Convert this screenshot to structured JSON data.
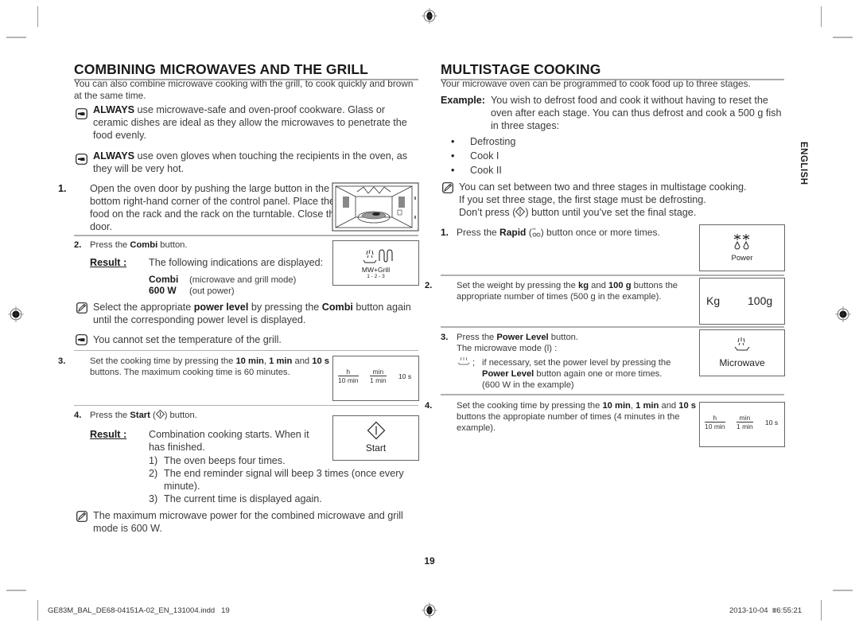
{
  "left": {
    "title": "COMBINING MICROWAVES AND THE GRILL",
    "intro": "You can also combine microwave cooking with the grill, to cook quickly and brown at the same time.",
    "warn1": {
      "bold": "ALWAYS",
      "text": " use microwave-safe and oven-proof cookware. Glass or ceramic dishes are ideal as they allow the microwaves to penetrate the food evenly."
    },
    "warn2": {
      "bold": "ALWAYS",
      "text": " use oven gloves when touching the recipients in the oven, as they will be very hot."
    },
    "step1": {
      "num": "1.",
      "text": "Open the oven door by pushing the large button in the bottom right-hand corner of the control panel. Place the food on the rack and the rack on the turntable. Close the door."
    },
    "step2": {
      "num": "2.",
      "pre": "Press the ",
      "bold": "Combi",
      "post": " button.",
      "result_label": "Result :",
      "result_text": "The following indications are displayed:",
      "ind1_label": "Combi",
      "ind1_desc": "(microwave and grill mode)",
      "ind2_label": "600 W",
      "ind2_desc": "(out power)",
      "display": {
        "label": "MW+Grill",
        "sub": "1 - 2 - 3"
      }
    },
    "note1": {
      "pre": "Select the appropriate ",
      "b1": "power level",
      "mid": " by pressing the ",
      "b2": "Combi",
      "post": " button again until the corresponding power level is displayed."
    },
    "warn3": "You cannot set the temperature of the grill.",
    "step3": {
      "num": "3.",
      "pre": "Set the cooking time by pressing the ",
      "b1": "10 min",
      "c1": ", ",
      "b2": "1 min",
      "c2": " and ",
      "b3": "10 s",
      "post": " buttons. The maximum cooking time is 60 minutes.",
      "display": {
        "h": "h",
        "h_sub": "10 min",
        "min": "min",
        "min_sub": "1 min",
        "s": "10 s"
      }
    },
    "step4": {
      "num": "4.",
      "pre": "Press the ",
      "bold": "Start",
      "post": " button.",
      "result_label": "Result :",
      "result_text": "Combination cooking starts. When it has finished.",
      "items": [
        {
          "n": "1)",
          "text": "The oven beeps four times."
        },
        {
          "n": "2)",
          "text": "The end reminder signal will beep 3 times (once every minute)."
        },
        {
          "n": "3)",
          "text": "The current time is displayed again."
        }
      ],
      "display": {
        "label": "Start"
      }
    },
    "note2": "The maximum microwave power for the combined microwave and grill mode is 600 W."
  },
  "right": {
    "title": "MULTISTAGE COOKING",
    "intro": "Your microwave oven can be programmed to cook food up to three stages.",
    "example_label": "Example:",
    "example_text": "You wish to defrost food and cook it without having to reset the oven after each stage. You can thus defrost and cook a 500 g fish in three stages:",
    "stages": [
      "Defrosting",
      "Cook I",
      "Cook II"
    ],
    "note": {
      "line1": "You can set between two and three stages in multistage cooking.",
      "line2": "If you set three stage, the first stage must be defrosting.",
      "line3_pre": "Don’t press (",
      "line3_post": ") button until you’ve set the final stage."
    },
    "step1": {
      "num": "1.",
      "pre": "Press the ",
      "bold": "Rapid",
      "post": " button once or more times.",
      "display": {
        "label": "Power"
      }
    },
    "step2": {
      "num": "2.",
      "pre": "Set the weight by pressing the ",
      "b1": "kg",
      "mid": " and ",
      "b2": "100 g",
      "post": " buttons the appropriate number of times (500 g in the example).",
      "display": {
        "kg": "Kg",
        "g": "100g"
      }
    },
    "step3": {
      "num": "3.",
      "pre": "Press the ",
      "bold": "Power Level",
      "post": " button.",
      "line2": "The microwave mode (l) :",
      "sub_sep": ";",
      "sub_pre": "if necessary, set the power level by pressing the ",
      "sub_bold": "Power Level",
      "sub_post": " button again one or more times.",
      "sub_line3": "(600 W in the example)",
      "display": {
        "label": "Microwave"
      }
    },
    "step4": {
      "num": "4.",
      "pre": "Set the cooking time by pressing the ",
      "b1": "10 min",
      "c1": ", ",
      "b2": "1 min",
      "c2": " and ",
      "b3": "10 s",
      "post": " buttons the appropiate number of times (4 minutes in the example).",
      "display": {
        "h": "h",
        "h_sub": "10 min",
        "min": "min",
        "min_sub": "1 min",
        "s": "10 s"
      }
    }
  },
  "side_tab": "ENGLISH",
  "page_number": "19",
  "footer": {
    "file": "GE83M_BAL_DE68-04151A-02_EN_131004.indd   19",
    "date": "2013-10-04",
    "time_glyph": "Ⅲ",
    "time": "6:55:21"
  }
}
